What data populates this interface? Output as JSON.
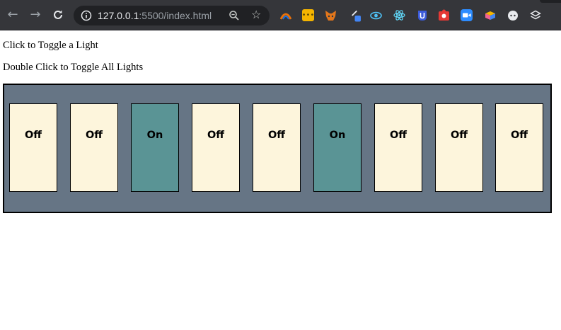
{
  "browser": {
    "url_host": "127.0.0.1",
    "url_rest": ":5500/index.html",
    "nav": {
      "back_icon": "arrow-left-icon",
      "forward_icon": "arrow-right-icon",
      "reload_icon": "reload-icon"
    },
    "extensions": [
      {
        "name": "colorful-extension-icon",
        "color": "#e8710a"
      },
      {
        "name": "yellow-dots-extension-icon",
        "color": "#f4b400"
      },
      {
        "name": "metamask-fox-icon",
        "color": "#e2761b"
      },
      {
        "name": "eyedropper-extension-icon",
        "color": "#4285f4"
      },
      {
        "name": "eye-extension-icon",
        "color": "#4fc3f7"
      },
      {
        "name": "react-devtools-icon",
        "color": "#61dafb"
      },
      {
        "name": "u-shield-extension-icon",
        "color": "#3b5bdb"
      },
      {
        "name": "red-puzzle-extension-icon",
        "color": "#e53935"
      },
      {
        "name": "zoom-extension-icon",
        "color": "#2d8cff"
      },
      {
        "name": "cube-extension-icon",
        "color": "#f06292"
      },
      {
        "name": "circle-extension-icon",
        "color": "#e8eaed"
      },
      {
        "name": "layers-extension-icon",
        "color": "#e8eaed"
      }
    ]
  },
  "page": {
    "instruction_1": "Click to Toggle a Light",
    "instruction_2": "Double Click to Toggle All Lights"
  },
  "colors": {
    "panel_bg": "#667585",
    "light_off": "#fdf5dc",
    "light_on": "#5a9495"
  },
  "lights": [
    {
      "label": "Off",
      "on": false
    },
    {
      "label": "Off",
      "on": false
    },
    {
      "label": "On",
      "on": true
    },
    {
      "label": "Off",
      "on": false
    },
    {
      "label": "Off",
      "on": false
    },
    {
      "label": "On",
      "on": true
    },
    {
      "label": "Off",
      "on": false
    },
    {
      "label": "Off",
      "on": false
    },
    {
      "label": "Off",
      "on": false
    }
  ]
}
